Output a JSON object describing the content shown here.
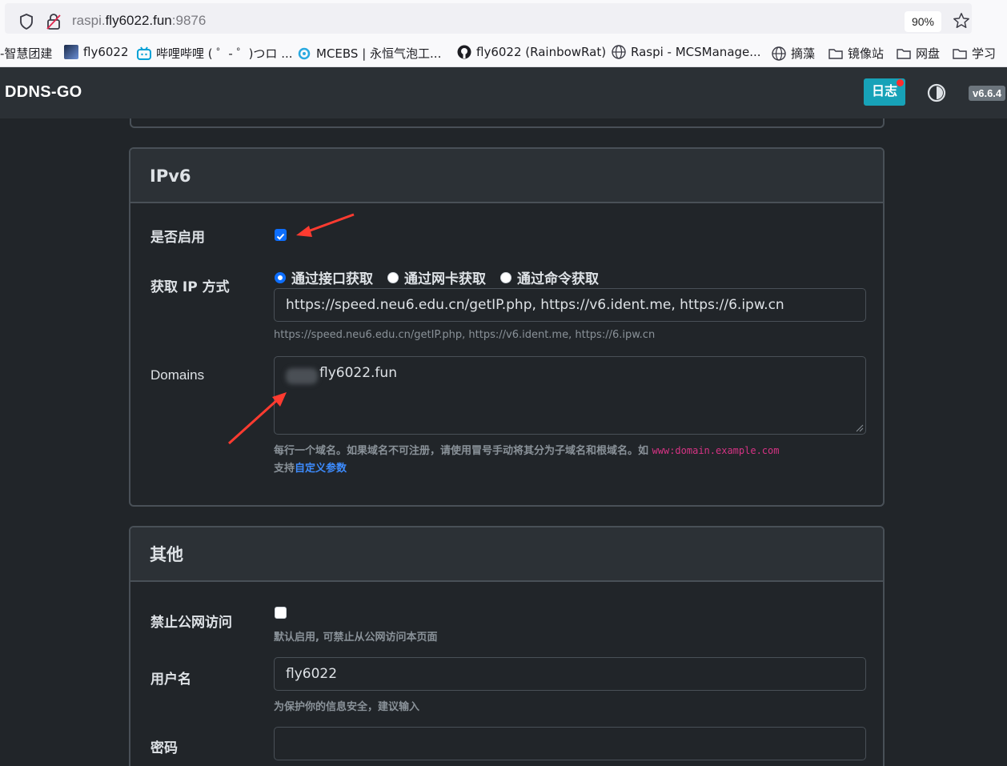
{
  "browser": {
    "url_host_prefix": "raspi.",
    "url_domain": "fly6022.fun",
    "url_port": ":9876",
    "zoom": "90%",
    "bookmarks": [
      {
        "label": "-智慧团建",
        "icon": "none"
      },
      {
        "label": "fly6022",
        "icon": "avatar-icon"
      },
      {
        "label": "哔哩哔哩 ( ゜- ゜)つロ ...",
        "icon": "bilibili-icon"
      },
      {
        "label": "MCEBS | 永恒气泡工...",
        "icon": "bubble-icon"
      },
      {
        "label": "fly6022 (RainbowRat)",
        "icon": "github-icon"
      },
      {
        "label": "Raspi - MCSManage...",
        "icon": "globe-icon"
      },
      {
        "label": "摘藻",
        "icon": "globe-icon"
      },
      {
        "label": "镜像站",
        "icon": "folder-icon"
      },
      {
        "label": "网盘",
        "icon": "folder-icon"
      },
      {
        "label": "学习",
        "icon": "folder-icon"
      }
    ]
  },
  "navbar": {
    "brand": "DDNS-GO",
    "log_button": "日志",
    "version": "v6.6.4"
  },
  "ipv6": {
    "title": "IPv6",
    "enable_label": "是否启用",
    "enable_checked": true,
    "method_label": "获取 IP 方式",
    "methods": [
      "通过接口获取",
      "通过网卡获取",
      "通过命令获取"
    ],
    "method_selected": 0,
    "url_value": "https://speed.neu6.edu.cn/getIP.php, https://v6.ident.me, https://6.ipw.cn",
    "url_hint": "https://speed.neu6.edu.cn/getIP.php, https://v6.ident.me, https://6.ipw.cn",
    "domains_label": "Domains",
    "domains_value": "fly6022.fun",
    "domains_hint": "每行一个域名。如果域名不可注册，请使用冒号手动将其分为子域名和根域名。如 ",
    "domains_hint_code": "www:domain.example.com",
    "custom_prefix": "支持",
    "custom_link": "自定义参数"
  },
  "other": {
    "title": "其他",
    "public_label": "禁止公网访问",
    "public_checked": false,
    "public_hint": "默认启用, 可禁止从公网访问本页面",
    "username_label": "用户名",
    "username_value": "fly6022",
    "username_hint": "为保护你的信息安全，建议输入",
    "password_label": "密码",
    "password_value": ""
  },
  "colors": {
    "accent": "#0d6efd",
    "log_button": "#17a2b8",
    "annotation_arrow": "#ff3b30"
  }
}
